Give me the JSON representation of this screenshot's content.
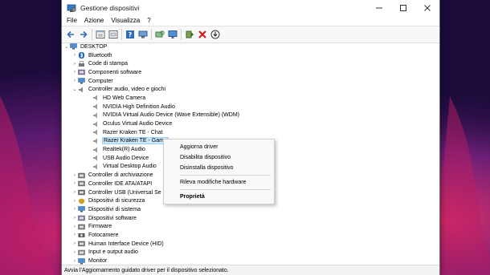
{
  "window": {
    "title": "Gestione dispositivi"
  },
  "menu": [
    "File",
    "Azione",
    "Visualizza",
    "?"
  ],
  "toolbar": {
    "icons": [
      "back-icon",
      "forward-icon",
      "properties-view-icon",
      "show-hidden-icon",
      "help-icon",
      "computer-icon",
      "scan-hardware-icon",
      "monitor-icon",
      "update-driver-icon",
      "uninstall-icon",
      "download-icon"
    ]
  },
  "tree": [
    {
      "label": "DESKTOP",
      "level": 0,
      "expander": "v",
      "icon": "computer-icon"
    },
    {
      "label": "Bluetooth",
      "level": 1,
      "expander": ">",
      "icon": "bluetooth-icon"
    },
    {
      "label": "Code di stampa",
      "level": 1,
      "expander": ">",
      "icon": "printer-icon"
    },
    {
      "label": "Componenti software",
      "level": 1,
      "expander": ">",
      "icon": "software-component-icon"
    },
    {
      "label": "Computer",
      "level": 1,
      "expander": ">",
      "icon": "computer-icon"
    },
    {
      "label": "Controller audio, video e giochi",
      "level": 1,
      "expander": "v",
      "icon": "audio-controller-icon"
    },
    {
      "label": "HD Web Camera",
      "level": 2,
      "expander": "",
      "icon": "audio-device-icon"
    },
    {
      "label": "NVIDIA High Definition Audio",
      "level": 2,
      "expander": "",
      "icon": "audio-device-icon"
    },
    {
      "label": "NVIDIA Virtual Audio Device (Wave Extensible) (WDM)",
      "level": 2,
      "expander": "",
      "icon": "audio-device-icon"
    },
    {
      "label": "Oculus Virtual Audio Device",
      "level": 2,
      "expander": "",
      "icon": "audio-device-icon"
    },
    {
      "label": "Razer Kraken TE - Chat",
      "level": 2,
      "expander": "",
      "icon": "audio-device-icon"
    },
    {
      "label": "Razer Kraken TE - Game",
      "level": 2,
      "expander": "",
      "icon": "audio-device-icon",
      "selected": true
    },
    {
      "label": "Realtek(R) Audio",
      "level": 2,
      "expander": "",
      "icon": "audio-device-icon"
    },
    {
      "label": "USB Audio Device",
      "level": 2,
      "expander": "",
      "icon": "audio-device-icon"
    },
    {
      "label": "Virtual Desktop Audio",
      "level": 2,
      "expander": "",
      "icon": "audio-device-icon"
    },
    {
      "label": "Controller di archiviazione",
      "level": 1,
      "expander": ">",
      "icon": "storage-controller-icon"
    },
    {
      "label": "Controller IDE ATA/ATAPI",
      "level": 1,
      "expander": ">",
      "icon": "ide-controller-icon"
    },
    {
      "label": "Controller USB (Universal Se",
      "level": 1,
      "expander": ">",
      "icon": "usb-controller-icon"
    },
    {
      "label": "Dispositivi di sicurezza",
      "level": 1,
      "expander": ">",
      "icon": "security-device-icon"
    },
    {
      "label": "Dispositivi di sistema",
      "level": 1,
      "expander": ">",
      "icon": "system-device-icon"
    },
    {
      "label": "Dispositivi software",
      "level": 1,
      "expander": ">",
      "icon": "software-device-icon"
    },
    {
      "label": "Firmware",
      "level": 1,
      "expander": ">",
      "icon": "firmware-icon"
    },
    {
      "label": "Fotocamere",
      "level": 1,
      "expander": ">",
      "icon": "camera-icon"
    },
    {
      "label": "Human Interface Device (HID)",
      "level": 1,
      "expander": ">",
      "icon": "hid-icon"
    },
    {
      "label": "Input e output audio",
      "level": 1,
      "expander": ">",
      "icon": "audio-io-icon"
    },
    {
      "label": "Monitor",
      "level": 1,
      "expander": ">",
      "icon": "monitor-icon"
    }
  ],
  "context_menu": {
    "items": [
      {
        "label": "Aggiorna driver",
        "bold": false
      },
      {
        "label": "Disabilita dispositivo",
        "bold": false
      },
      {
        "label": "Disinstalla dispositivo",
        "bold": false
      },
      {
        "sep": true
      },
      {
        "label": "Rileva modifiche hardware",
        "bold": false
      },
      {
        "sep": true
      },
      {
        "label": "Proprietà",
        "bold": true
      }
    ]
  },
  "status": {
    "text": "Avvia l'Aggiornamento guidato driver per il dispositivo selezionato."
  },
  "colors": {
    "selection": "#cce8ff",
    "selection_border": "#99d1ff",
    "wallpaper_dark": "#1a0b3a",
    "wallpaper_accent": "#d2246e"
  }
}
